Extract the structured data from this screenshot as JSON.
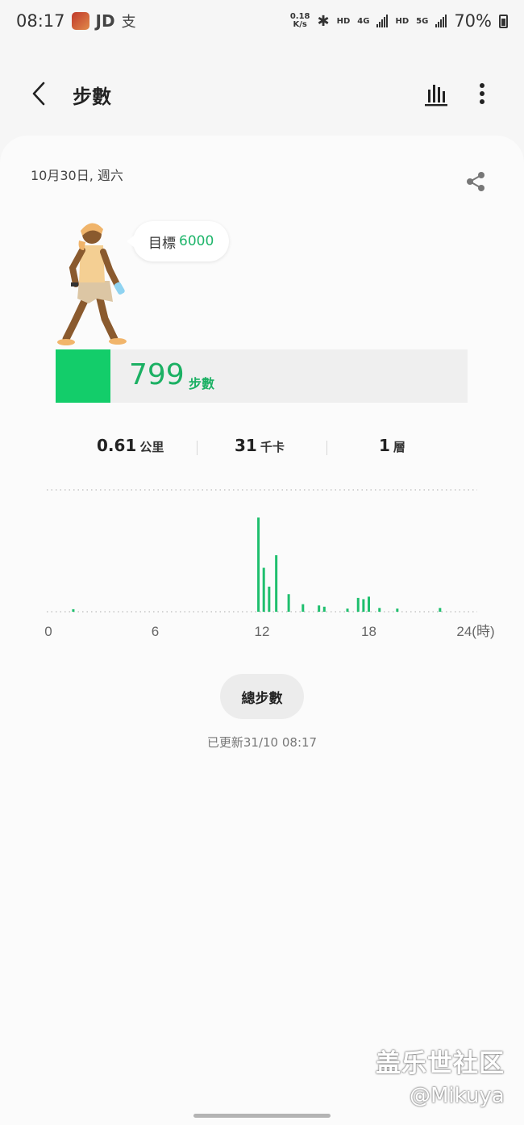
{
  "status_bar": {
    "time": "08:17",
    "app_icons": [
      "game-avatar-icon",
      "jd-icon",
      "zhi-icon"
    ],
    "jd_label": "JD",
    "zhi_label": "支",
    "net_speed_value": "0.18",
    "net_speed_unit": "K/s",
    "hd_label_1": "HD",
    "net_4g": "4G",
    "hd_label_2": "HD",
    "net_5g": "5G",
    "battery": "70%"
  },
  "header": {
    "title": "步數",
    "back_icon": "chevron-left-icon",
    "chart_icon": "bar-chart-icon",
    "more_icon": "more-vertical-icon"
  },
  "card": {
    "date": "10月30日, 週六",
    "share_icon": "share-icon",
    "goal_label": "目標",
    "goal_value": "6000",
    "steps_value": "799",
    "steps_unit": "步數",
    "progress_fraction": 0.133,
    "metrics": [
      {
        "value": "0.61",
        "unit": "公里"
      },
      {
        "value": "31",
        "unit": "千卡"
      },
      {
        "value": "1",
        "unit": "層"
      }
    ],
    "total_button": "總步數",
    "updated": "已更新31/10 08:17"
  },
  "chart_data": {
    "type": "bar",
    "x_ticks": [
      "0",
      "6",
      "12",
      "18",
      "24(時)"
    ],
    "xlim": [
      0,
      24
    ],
    "ylim": [
      0,
      180
    ],
    "bars": [
      {
        "hour": 1.4,
        "value": 4
      },
      {
        "hour": 11.8,
        "value": 150
      },
      {
        "hour": 12.1,
        "value": 70
      },
      {
        "hour": 12.4,
        "value": 40
      },
      {
        "hour": 12.8,
        "value": 90
      },
      {
        "hour": 13.5,
        "value": 28
      },
      {
        "hour": 14.3,
        "value": 12
      },
      {
        "hour": 15.2,
        "value": 10
      },
      {
        "hour": 15.5,
        "value": 8
      },
      {
        "hour": 16.8,
        "value": 5
      },
      {
        "hour": 17.4,
        "value": 22
      },
      {
        "hour": 17.7,
        "value": 20
      },
      {
        "hour": 18.0,
        "value": 24
      },
      {
        "hour": 18.6,
        "value": 6
      },
      {
        "hour": 19.6,
        "value": 5
      },
      {
        "hour": 22.0,
        "value": 6
      }
    ],
    "bar_color": "#1fbf6e"
  },
  "watermark": {
    "line1": "盖乐世社区",
    "line2": "@Mikuya"
  }
}
